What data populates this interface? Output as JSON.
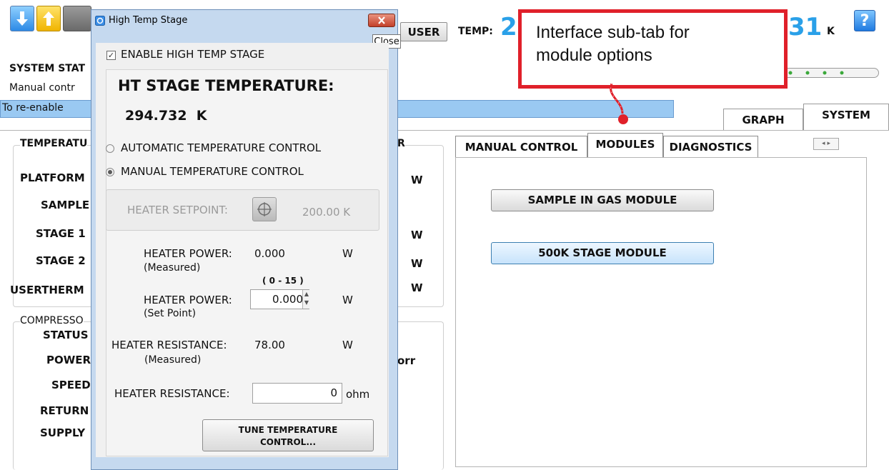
{
  "toolbar": {
    "user_label": "USER",
    "temp_label": "TEMP:",
    "temp_value_left": "2",
    "temp_value_right": "31",
    "temp_unit": "K",
    "help_label": "?"
  },
  "system_status": {
    "line1": "SYSTEM STAT",
    "line2": "Manual contr",
    "line3": "To re-enable"
  },
  "main_tabs": [
    {
      "label": "GRAPH"
    },
    {
      "label": "SYSTEM"
    }
  ],
  "left_panel": {
    "temperature_header": "TEMPERATU",
    "header_suffix": "R",
    "rows": [
      {
        "label": "PLATFORM",
        "unit": "W"
      },
      {
        "label": "SAMPLE",
        "unit": ""
      },
      {
        "label": "STAGE 1",
        "unit": "W"
      },
      {
        "label": "STAGE 2",
        "unit": "W"
      },
      {
        "label": "USERTHERM",
        "unit": "W"
      }
    ],
    "compressor_header": "COMPRESSO",
    "compressor_rows": [
      {
        "label": "STATUS"
      },
      {
        "label": "POWER"
      },
      {
        "label": "SPEED"
      },
      {
        "label": "RETURN"
      },
      {
        "label": "SUPPLY"
      }
    ],
    "pressure_unit": "orr"
  },
  "sub_tabs": [
    {
      "label": "MANUAL CONTROL"
    },
    {
      "label": "MODULES"
    },
    {
      "label": "DIAGNOSTICS"
    }
  ],
  "modules": [
    {
      "label": "SAMPLE IN GAS MODULE"
    },
    {
      "label": "500K STAGE MODULE"
    }
  ],
  "dialog": {
    "title": "High Temp Stage",
    "close_tooltip": "Close",
    "enable_label": "ENABLE HIGH TEMP STAGE",
    "enable_checked": true,
    "ht_title": "HT STAGE TEMPERATURE:",
    "ht_value": "294.732  K",
    "auto_label": "AUTOMATIC TEMPERATURE CONTROL",
    "manual_label": "MANUAL TEMPERATURE CONTROL",
    "selected_mode": "manual",
    "setpoint_label": "HEATER SETPOINT:",
    "setpoint_value": "200.00 K",
    "power_measured_label": "HEATER POWER:",
    "power_measured_sub": "(Measured)",
    "power_measured_value": "0.000",
    "power_measured_unit": "W",
    "power_range": "( 0 - 15 )",
    "power_set_label": "HEATER POWER:",
    "power_set_sub": "(Set Point)",
    "power_set_value": "0.000",
    "power_set_unit": "W",
    "resistance_measured_label": "HEATER RESISTANCE:",
    "resistance_measured_sub": "(Measured)",
    "resistance_measured_value": "78.00",
    "resistance_measured_unit": "W",
    "resistance_label": "HEATER RESISTANCE:",
    "resistance_value": "0",
    "resistance_unit": "ohm",
    "tune_line1": "TUNE TEMPERATURE",
    "tune_line2": "CONTROL..."
  },
  "callout": {
    "text": "Interface sub-tab for\nmodule options",
    "border_color": "#e0202a"
  }
}
